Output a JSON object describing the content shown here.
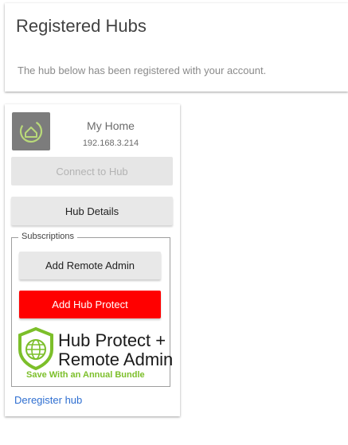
{
  "header": {
    "title": "Registered Hubs",
    "subtitle": "The hub below has been registered with your account."
  },
  "hub": {
    "avatar_icon": "home-hub-icon",
    "name": "My Home",
    "ip": "192.168.3.214",
    "connect_label": "Connect to Hub",
    "details_label": "Hub Details",
    "subscriptions": {
      "legend": "Subscriptions",
      "remote_admin_label": "Add Remote Admin",
      "hub_protect_label": "Add Hub Protect",
      "promo": {
        "line1": "Hub Protect +",
        "line2": "Remote Admin",
        "tagline": "Save With an Annual Bundle",
        "icon": "globe-shield-icon"
      }
    },
    "deregister_label": "Deregister hub"
  },
  "colors": {
    "accent_red": "#ff0000",
    "link_blue": "#2f6fd1",
    "promo_green": "#7cbf2a"
  }
}
